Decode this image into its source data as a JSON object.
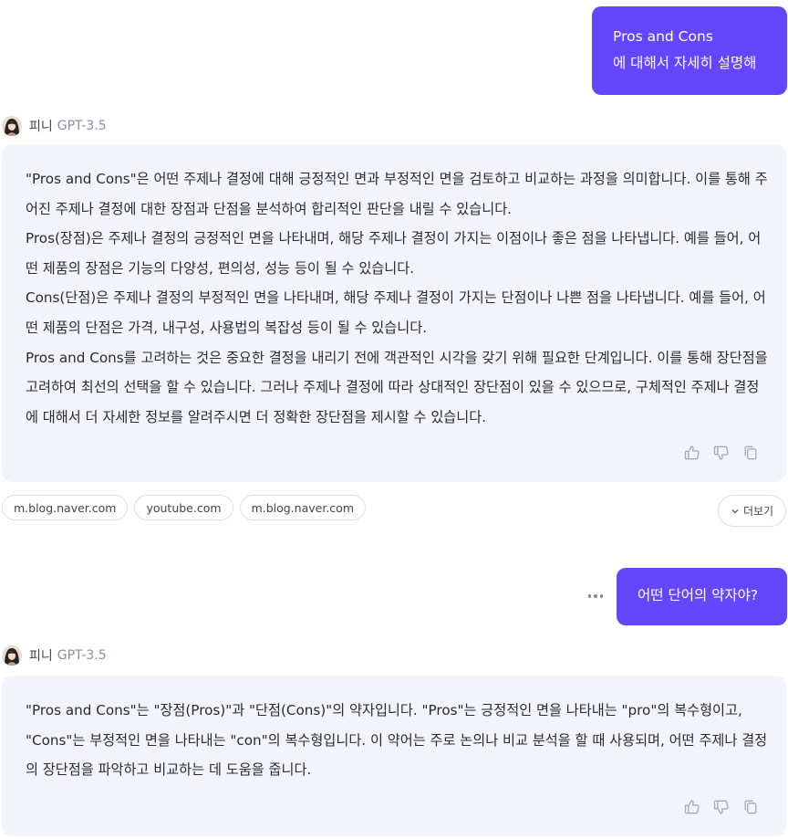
{
  "messages": {
    "user_1": {
      "line1": "Pros and Cons",
      "line2": "에 대해서 자세히 설명해"
    },
    "bot_1": {
      "name": "피니",
      "model": "GPT-3.5",
      "paragraphs": [
        "\"Pros and Cons\"은 어떤 주제나 결정에 대해 긍정적인 면과 부정적인 면을 검토하고 비교하는 과정을 의미합니다. 이를 통해 주어진 주제나 결정에 대한 장점과 단점을 분석하여 합리적인 판단을 내릴 수 있습니다.",
        "Pros(장점)은 주제나 결정의 긍정적인 면을 나타내며, 해당 주제나 결정이 가지는 이점이나 좋은 점을 나타냅니다. 예를 들어, 어떤 제품의 장점은 기능의 다양성, 편의성, 성능 등이 될 수 있습니다.",
        "Cons(단점)은 주제나 결정의 부정적인 면을 나타내며, 해당 주제나 결정이 가지는 단점이나 나쁜 점을 나타냅니다. 예를 들어, 어떤 제품의 단점은 가격, 내구성, 사용법의 복잡성 등이 될 수 있습니다.",
        "Pros and Cons를 고려하는 것은 중요한 결정을 내리기 전에 객관적인 시각을 갖기 위해 필요한 단계입니다. 이를 통해 장단점을 고려하여 최선의 선택을 할 수 있습니다. 그러나 주제나 결정에 따라 상대적인 장단점이 있을 수 있으므로, 구체적인 주제나 결정에 대해서 더 자세한 정보를 알려주시면 더 정확한 장단점을 제시할 수 있습니다."
      ]
    },
    "sources": [
      "m.blog.naver.com",
      "youtube.com",
      "m.blog.naver.com"
    ],
    "more_label": "더보기",
    "user_2": {
      "text": "어떤 단어의 약자야?"
    },
    "bot_2": {
      "name": "피니",
      "model": "GPT-3.5",
      "paragraphs": [
        "\"Pros and Cons\"는 \"장점(Pros)\"과 \"단점(Cons)\"의 약자입니다. \"Pros\"는 긍정적인 면을 나타내는 \"pro\"의 복수형이고, \"Cons\"는 부정적인 면을 나타내는 \"con\"의 복수형입니다. 이 약어는 주로 논의나 비교 분석을 할 때 사용되며, 어떤 주제나 결정의 장단점을 파악하고 비교하는 데 도움을 줍니다."
      ]
    }
  },
  "icons": {
    "like": "thumbs-up-icon",
    "dislike": "thumbs-down-icon",
    "copy": "copy-icon",
    "more": "ellipsis-icon",
    "expand": "chevron-down-icon"
  },
  "colors": {
    "accent": "#6446ff",
    "answer_bg": "#f1f5fb",
    "model_text": "#8a8fa0"
  }
}
